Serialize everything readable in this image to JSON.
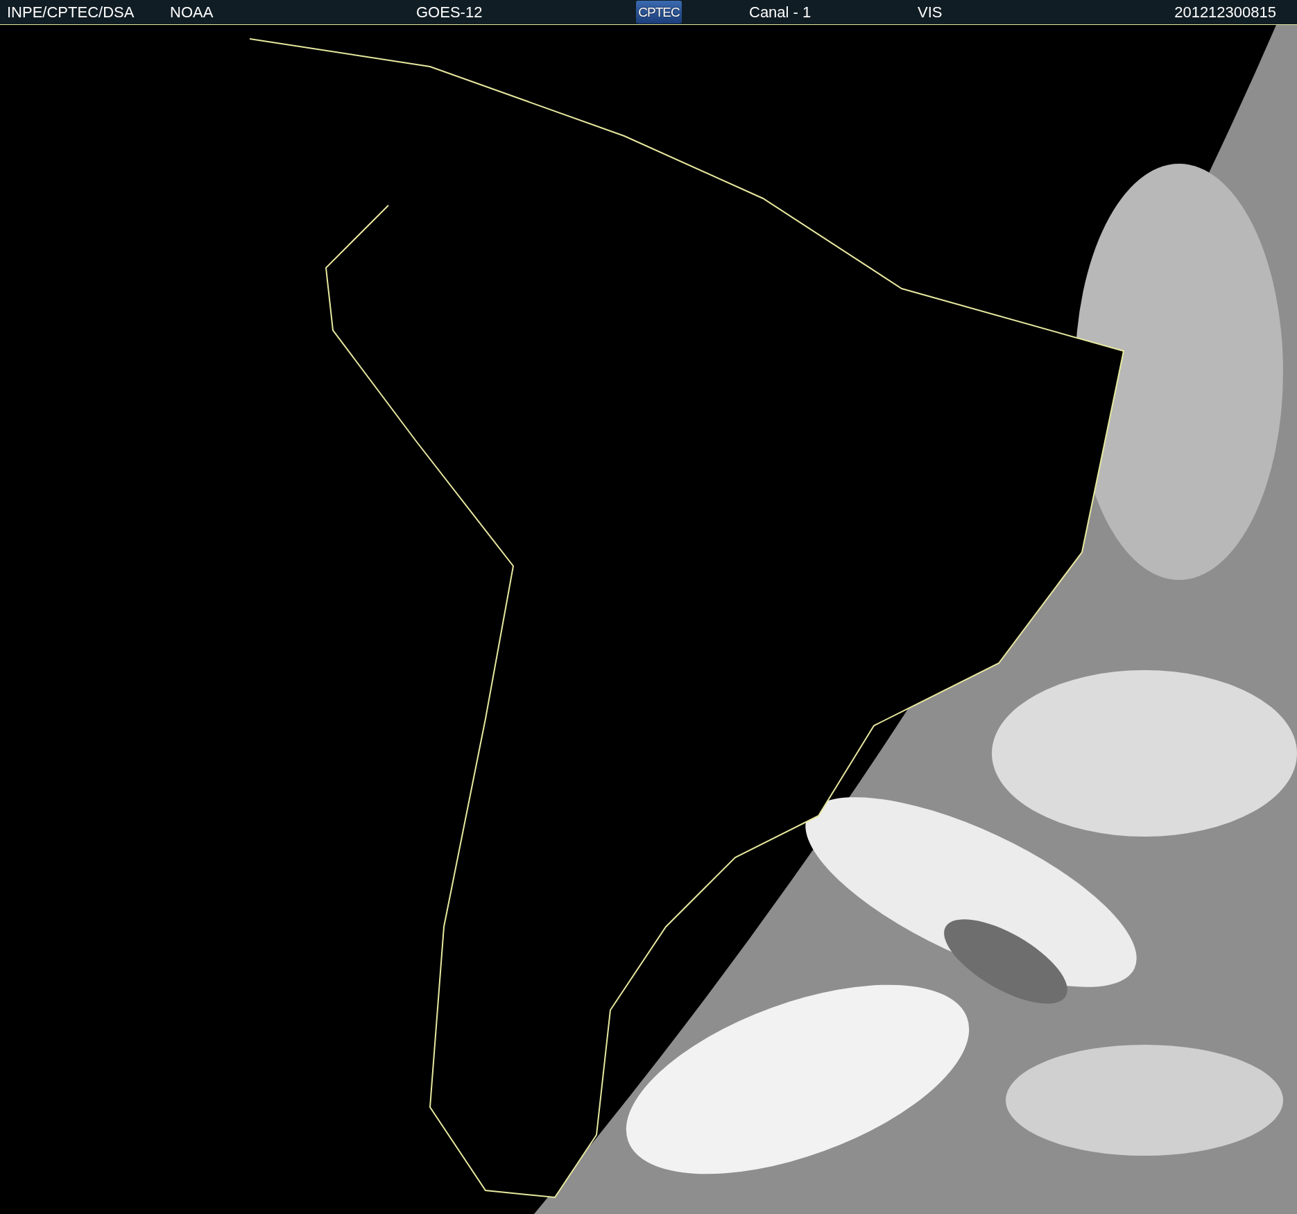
{
  "header": {
    "items": [
      {
        "kind": "text",
        "text": "INPE/CPTEC/DSA"
      },
      {
        "kind": "text",
        "text": "NOAA"
      },
      {
        "kind": "text",
        "text": "GOES-12"
      },
      {
        "kind": "logo",
        "text": "CPTEC"
      },
      {
        "kind": "text",
        "text": "Canal - 1"
      },
      {
        "kind": "text",
        "text": "VIS"
      },
      {
        "kind": "text",
        "text": "201212300815"
      }
    ]
  }
}
